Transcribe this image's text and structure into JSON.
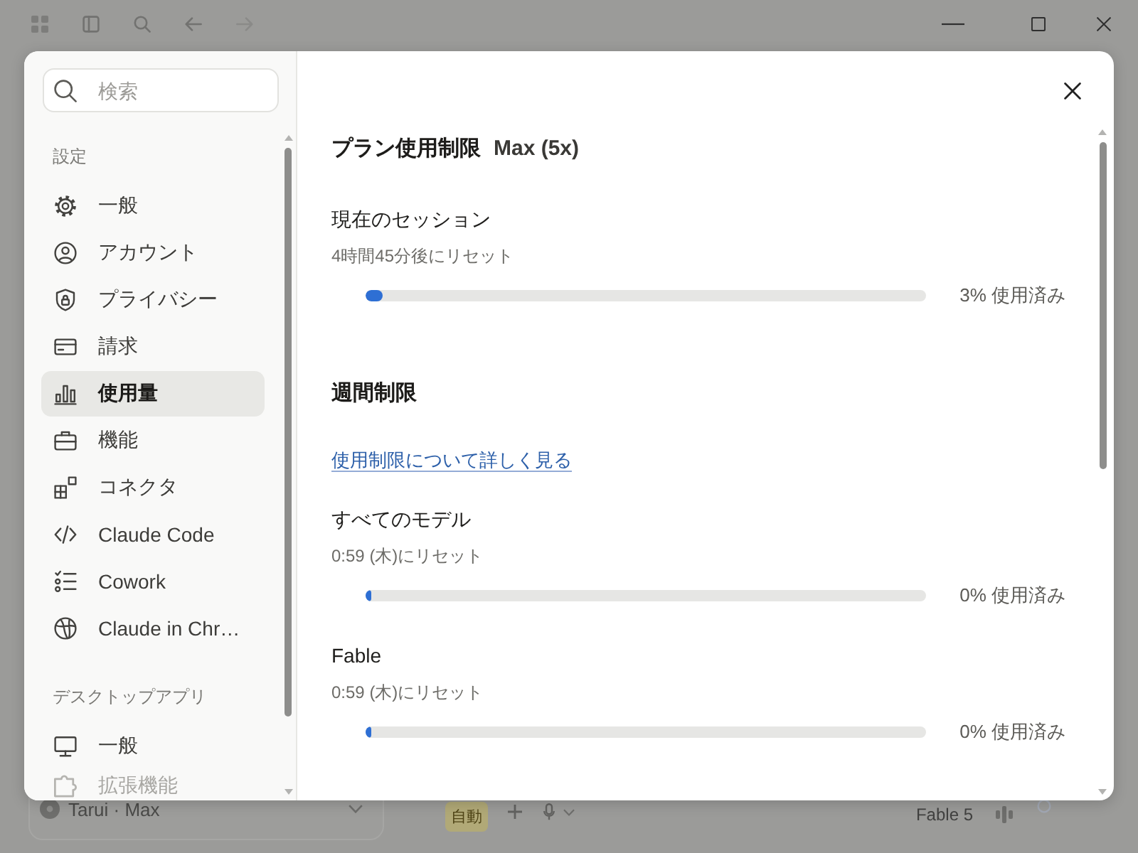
{
  "settings_modal": {
    "search": {
      "placeholder": "検索"
    },
    "sidebar": [
      {
        "heading": "設定",
        "items": [
          {
            "label": "一般",
            "selected": false
          },
          {
            "label": "アカウント",
            "selected": false
          },
          {
            "label": "プライバシー",
            "selected": false
          },
          {
            "label": "請求",
            "selected": false
          },
          {
            "label": "使用量",
            "selected": true
          },
          {
            "label": "機能",
            "selected": false
          },
          {
            "label": "コネクタ",
            "selected": false
          },
          {
            "label": "Claude Code",
            "selected": false
          },
          {
            "label": "Cowork",
            "selected": false
          },
          {
            "label": "Claude in Chr…",
            "selected": false
          }
        ]
      },
      {
        "heading": "デスクトップアプリ",
        "items": [
          {
            "label": "一般",
            "selected": false
          },
          {
            "label": "拡張機能",
            "selected": false
          }
        ]
      }
    ],
    "usage": {
      "title": "プラン使用制限",
      "plan": "Max (5x)",
      "session": {
        "title": "現在のセッション",
        "reset": "4時間45分後にリセット",
        "level": 0.03,
        "reading": "3% 使用済み"
      },
      "weekly": {
        "title": "週間制限",
        "link": "使用制限について詳しく見る",
        "limits": [
          {
            "name": "すべてのモデル",
            "reset": "0:59 (木)にリセット",
            "level": 0,
            "reading": "0% 使用済み"
          },
          {
            "name": "Fable",
            "reset": "0:59 (木)にリセット",
            "level": 0,
            "reading": "0% 使用済み"
          }
        ]
      }
    }
  },
  "background_app": {
    "model_selector": "Tarui · Max",
    "mode_chip": "自動",
    "model_label": "Fable 5"
  }
}
